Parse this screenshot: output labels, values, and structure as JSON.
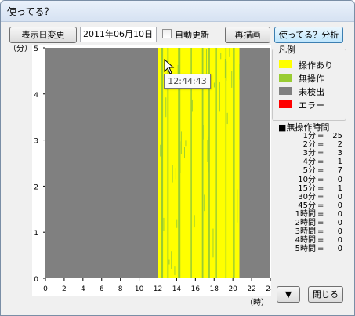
{
  "window": {
    "title": "使ってる？"
  },
  "toolbar": {
    "change_date_label": "表示日変更",
    "date_value": "2011年06月10日",
    "auto_update_label": "自動更新",
    "auto_update_checked": false,
    "redraw_label": "再描画",
    "analyze_label": "使ってる？分析"
  },
  "tooltip": {
    "text": "12:44:43"
  },
  "legend": {
    "title": "凡例",
    "items": [
      {
        "label": "操作あり",
        "color": "#ffff00"
      },
      {
        "label": "無操作",
        "color": "#99cc33"
      },
      {
        "label": "未検出",
        "color": "#808080"
      },
      {
        "label": "エラー",
        "color": "#ff0000"
      }
    ]
  },
  "stats": {
    "title": "■無操作時間",
    "rows": [
      {
        "label": "1分",
        "value": "25"
      },
      {
        "label": "2分",
        "value": "2"
      },
      {
        "label": "3分",
        "value": "3"
      },
      {
        "label": "4分",
        "value": "1"
      },
      {
        "label": "5分",
        "value": "7"
      },
      {
        "label": "10分",
        "value": "0"
      },
      {
        "label": "15分",
        "value": "1"
      },
      {
        "label": "30分",
        "value": "0"
      },
      {
        "label": "45分",
        "value": "0"
      },
      {
        "label": "1時間",
        "value": "0"
      },
      {
        "label": "2時間",
        "value": "0"
      },
      {
        "label": "3時間",
        "value": "0"
      },
      {
        "label": "4時間",
        "value": "0"
      },
      {
        "label": "5時間",
        "value": "0"
      }
    ]
  },
  "buttons": {
    "scroll_down_glyph": "▼",
    "close_label": "閉じる"
  },
  "chart_data": {
    "type": "heatmap",
    "ylabel": "（分）",
    "xlabel": "（時）",
    "xlim": [
      0,
      24
    ],
    "ylim": [
      0,
      5
    ],
    "x_ticks": [
      "0",
      "2",
      "4",
      "6",
      "8",
      "10",
      "12",
      "14",
      "16",
      "18",
      "20",
      "22",
      "24"
    ],
    "y_ticks": [
      "0",
      "1",
      "2",
      "3",
      "4",
      "5"
    ],
    "background_color": "#808080",
    "activity_range_hours": [
      12.0,
      20.7
    ],
    "colors": {
      "operated": "#ffff00",
      "idle": "#99cc33",
      "not_detected": "#808080"
    },
    "idle_bands_hours": [
      [
        12.3,
        12.55
      ],
      [
        13.0,
        13.15
      ],
      [
        14.15,
        14.4
      ],
      [
        15.5,
        15.62
      ],
      [
        16.7,
        16.85
      ],
      [
        17.4,
        17.55
      ],
      [
        18.1,
        18.3
      ],
      [
        19.2,
        19.32
      ],
      [
        20.0,
        20.2
      ]
    ]
  }
}
